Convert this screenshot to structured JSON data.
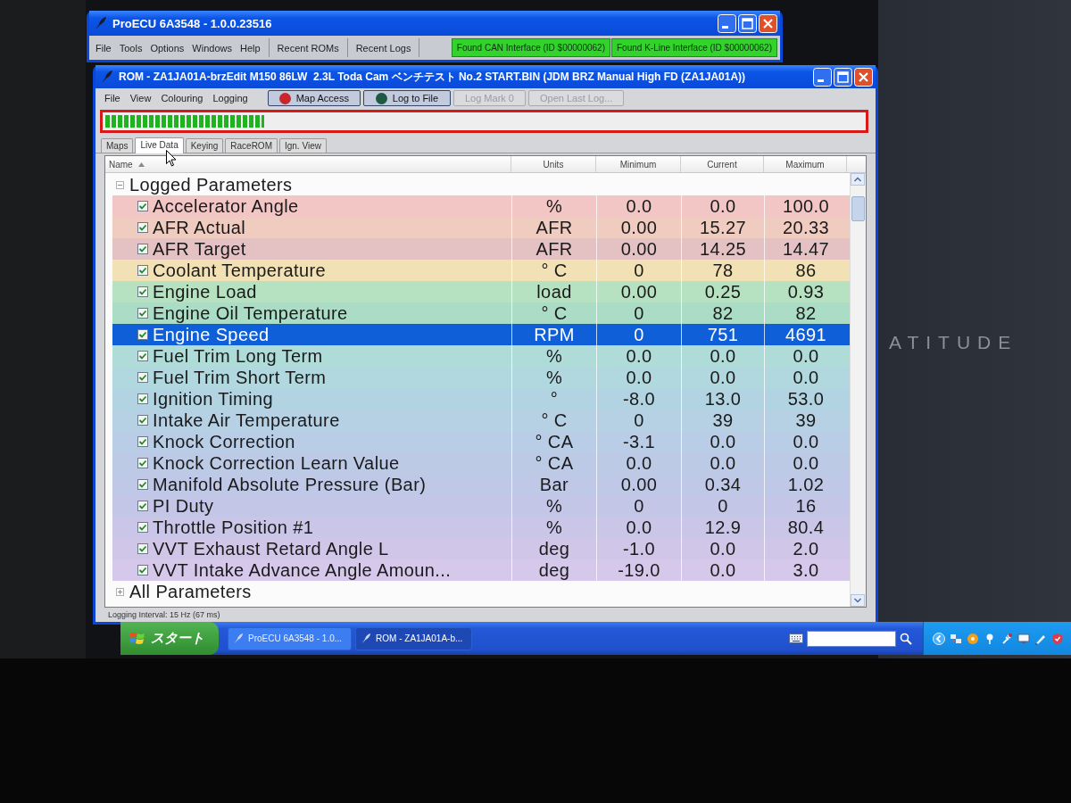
{
  "app_window": {
    "title": "ProECU 6A3548 - 1.0.0.23516",
    "menu": [
      "File",
      "Tools",
      "Options",
      "Windows",
      "Help"
    ],
    "buttons": [
      "Recent ROMs",
      "Recent Logs"
    ],
    "status_panels": [
      "Found CAN Interface (ID $00000062)",
      "Found K-Line Interface (ID $00000062)"
    ]
  },
  "rom_window": {
    "title": "ROM - ZA1JA01A-brzEdit M150 86LW  2.3L Toda Cam ベンチテスト No.2 START.BIN (JDM BRZ Manual High FD (ZA1JA01A))",
    "menu": [
      "File",
      "View",
      "Colouring",
      "Logging"
    ],
    "toolbar": [
      {
        "label": "Map Access",
        "color": "#c8262a",
        "disabled": false
      },
      {
        "label": "Log to File",
        "color": "#1d5a42",
        "disabled": false
      },
      {
        "label": "Log Mark 0",
        "disabled": true
      },
      {
        "label": "Open Last Log...",
        "disabled": true
      }
    ],
    "progress": {
      "level": 0.21
    },
    "tabs": [
      {
        "label": "Maps",
        "selected": false
      },
      {
        "label": "Live Data",
        "selected": true
      },
      {
        "label": "Keying",
        "selected": false
      },
      {
        "label": "RaceROM",
        "selected": false
      },
      {
        "label": "Ign. View",
        "selected": false
      }
    ],
    "columns": [
      {
        "label": "Name",
        "sorted": true
      },
      {
        "label": "Units",
        "sorted": false
      },
      {
        "label": "Minimum",
        "sorted": false
      },
      {
        "label": "Current",
        "sorted": false
      },
      {
        "label": "Maximum",
        "sorted": false
      }
    ],
    "groups": [
      {
        "label": "Logged Parameters",
        "expanded": true,
        "children": [
          {
            "name": "Accelerator Angle",
            "checked": true,
            "units": "%",
            "minimum": "0.0",
            "current": "0.0",
            "maximum": "100.0",
            "color": "#f3c6c6",
            "selected": false
          },
          {
            "name": "AFR Actual",
            "checked": true,
            "units": "AFR",
            "minimum": "0.00",
            "current": "15.27",
            "maximum": "20.33",
            "color": "#f0cbc0",
            "selected": false
          },
          {
            "name": "AFR Target",
            "checked": true,
            "units": "AFR",
            "minimum": "0.00",
            "current": "14.25",
            "maximum": "14.47",
            "color": "#e4c2c4",
            "selected": false
          },
          {
            "name": "Coolant Temperature",
            "checked": true,
            "units": "° C",
            "minimum": "0",
            "current": "78",
            "maximum": "86",
            "color": "#f1e1b4",
            "selected": false
          },
          {
            "name": "Engine Load",
            "checked": true,
            "units": "load",
            "minimum": "0.00",
            "current": "0.25",
            "maximum": "0.93",
            "color": "#b6e2c2",
            "selected": false
          },
          {
            "name": "Engine Oil Temperature",
            "checked": true,
            "units": "° C",
            "minimum": "0",
            "current": "82",
            "maximum": "82",
            "color": "#aadcc6",
            "selected": false
          },
          {
            "name": "Engine Speed",
            "checked": true,
            "units": "RPM",
            "minimum": "0",
            "current": "751",
            "maximum": "4691",
            "selected": true
          },
          {
            "name": "Fuel Trim Long Term",
            "checked": true,
            "units": "%",
            "minimum": "0.0",
            "current": "0.0",
            "maximum": "0.0",
            "color": "#afdcd8",
            "selected": false
          },
          {
            "name": "Fuel Trim Short Term",
            "checked": true,
            "units": "%",
            "minimum": "0.0",
            "current": "0.0",
            "maximum": "0.0",
            "color": "#b0d8de",
            "selected": false
          },
          {
            "name": "Ignition Timing",
            "checked": true,
            "units": "°",
            "minimum": "-8.0",
            "current": "13.0",
            "maximum": "53.0",
            "color": "#b2d4e2",
            "selected": false
          },
          {
            "name": "Intake Air Temperature",
            "checked": true,
            "units": "° C",
            "minimum": "0",
            "current": "39",
            "maximum": "39",
            "color": "#b6d0e4",
            "selected": false
          },
          {
            "name": "Knock Correction",
            "checked": true,
            "units": "° CA",
            "minimum": "-3.1",
            "current": "0.0",
            "maximum": "0.0",
            "color": "#b9cde6",
            "selected": false
          },
          {
            "name": "Knock Correction Learn Value",
            "checked": true,
            "units": "° CA",
            "minimum": "0.0",
            "current": "0.0",
            "maximum": "0.0",
            "color": "#bccae6",
            "selected": false
          },
          {
            "name": "Manifold Absolute Pressure (Bar)",
            "checked": true,
            "units": "Bar",
            "minimum": "0.00",
            "current": "0.34",
            "maximum": "1.02",
            "color": "#c0c8e8",
            "selected": false
          },
          {
            "name": "PI Duty",
            "checked": true,
            "units": "%",
            "minimum": "0",
            "current": "0",
            "maximum": "16",
            "color": "#c4c6e8",
            "selected": false
          },
          {
            "name": "Throttle Position #1",
            "checked": true,
            "units": "%",
            "minimum": "0.0",
            "current": "12.9",
            "maximum": "80.4",
            "color": "#c9c6e8",
            "selected": false
          },
          {
            "name": "VVT Exhaust Retard Angle L",
            "checked": true,
            "units": "deg",
            "minimum": "-1.0",
            "current": "0.0",
            "maximum": "2.0",
            "color": "#cfc6e8",
            "selected": false
          },
          {
            "name": "VVT Intake Advance Angle Amoun...",
            "checked": true,
            "units": "deg",
            "minimum": "-19.0",
            "current": "0.0",
            "maximum": "3.0",
            "color": "#d6c8ea",
            "selected": false
          }
        ]
      },
      {
        "label": "All Parameters",
        "expanded": false
      }
    ],
    "status_bar": "Logging Interval: 15 Hz (67 ms)"
  },
  "taskbar": {
    "start": "スタート",
    "tasks": [
      {
        "label": "ProECU 6A3548 - 1.0...",
        "selected": false
      },
      {
        "label": "ROM - ZA1JA01A-b...",
        "selected": true
      }
    ]
  },
  "bezel_label": "ATITUDE"
}
